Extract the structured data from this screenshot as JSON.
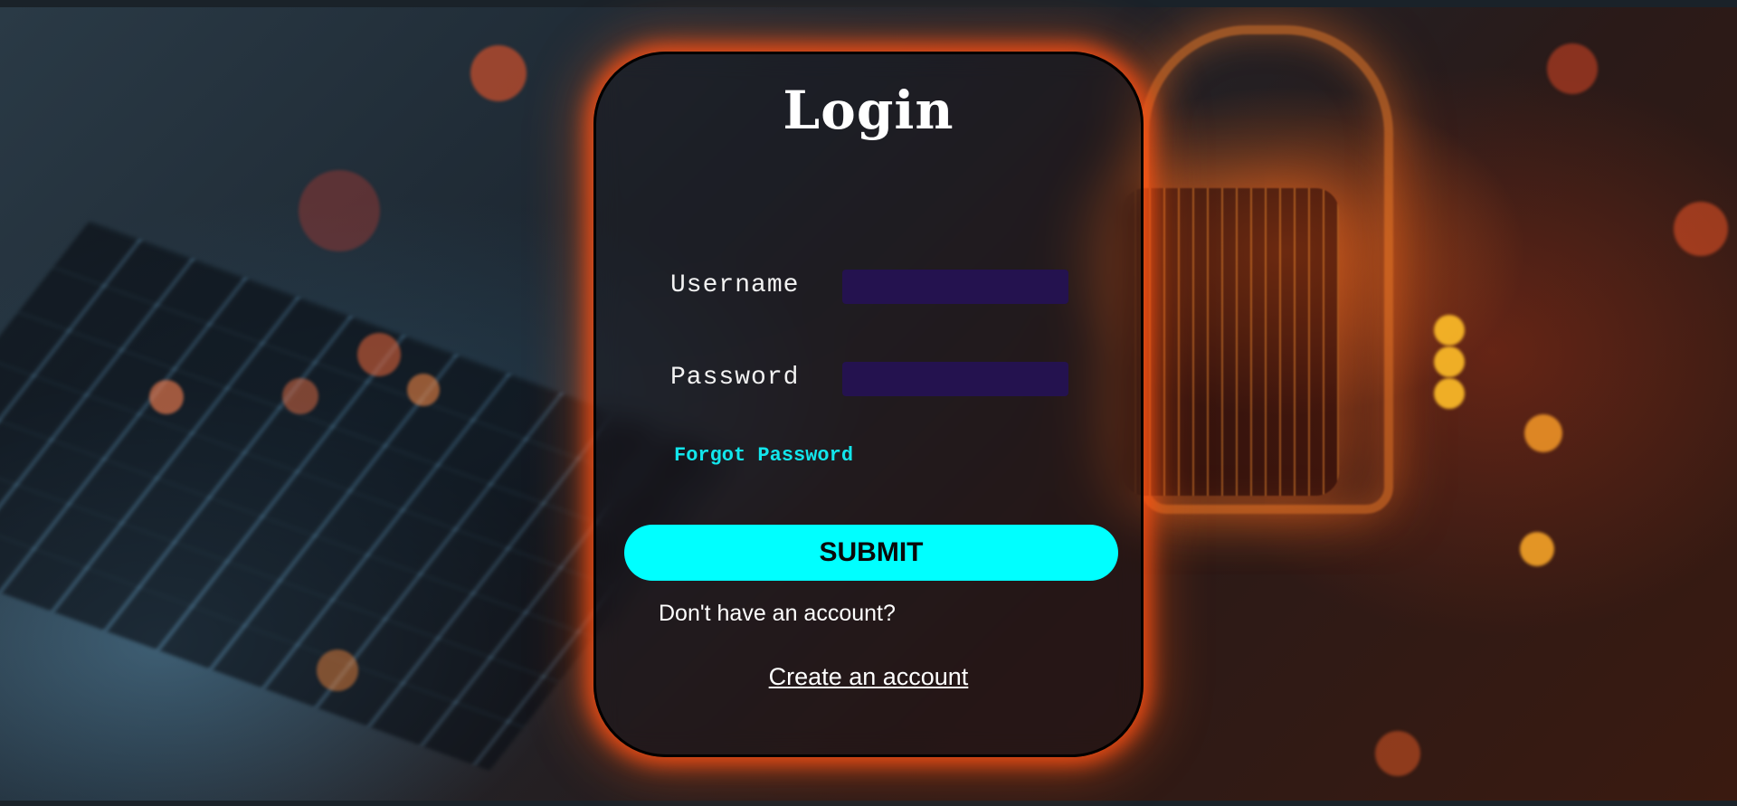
{
  "login_form": {
    "title": "Login",
    "username_label": "Username",
    "username_value": "",
    "password_label": "Password",
    "password_value": "",
    "forgot_password_link": "Forgot Password",
    "submit_button": "SUBMIT",
    "no_account_text": "Don't have an account?",
    "create_account_link": "Create an account"
  },
  "colors": {
    "accent": "#00ffff",
    "link": "#12e6ec",
    "input_background": "#24124f",
    "card_glow": "#ff5014",
    "text": "#ffffff"
  }
}
